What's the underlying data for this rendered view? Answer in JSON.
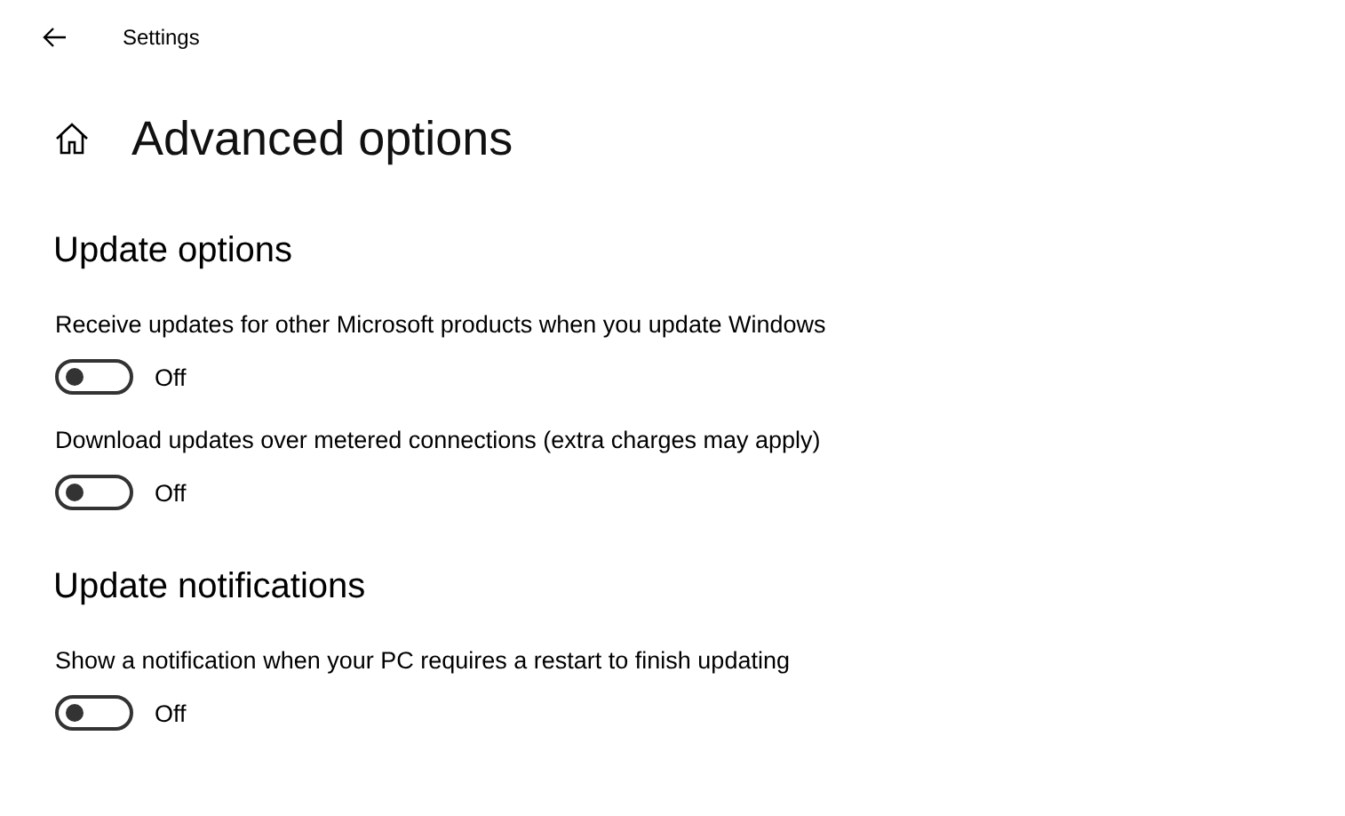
{
  "window": {
    "title": "Settings"
  },
  "page": {
    "title": "Advanced options"
  },
  "sections": [
    {
      "heading": "Update options",
      "settings": [
        {
          "label": "Receive updates for other Microsoft products when you update Windows",
          "on": false,
          "state_text": "Off"
        },
        {
          "label": "Download updates over metered connections (extra charges may apply)",
          "on": false,
          "state_text": "Off"
        }
      ]
    },
    {
      "heading": "Update notifications",
      "settings": [
        {
          "label": "Show a notification when your PC requires a restart to finish updating",
          "on": false,
          "state_text": "Off"
        }
      ]
    }
  ]
}
